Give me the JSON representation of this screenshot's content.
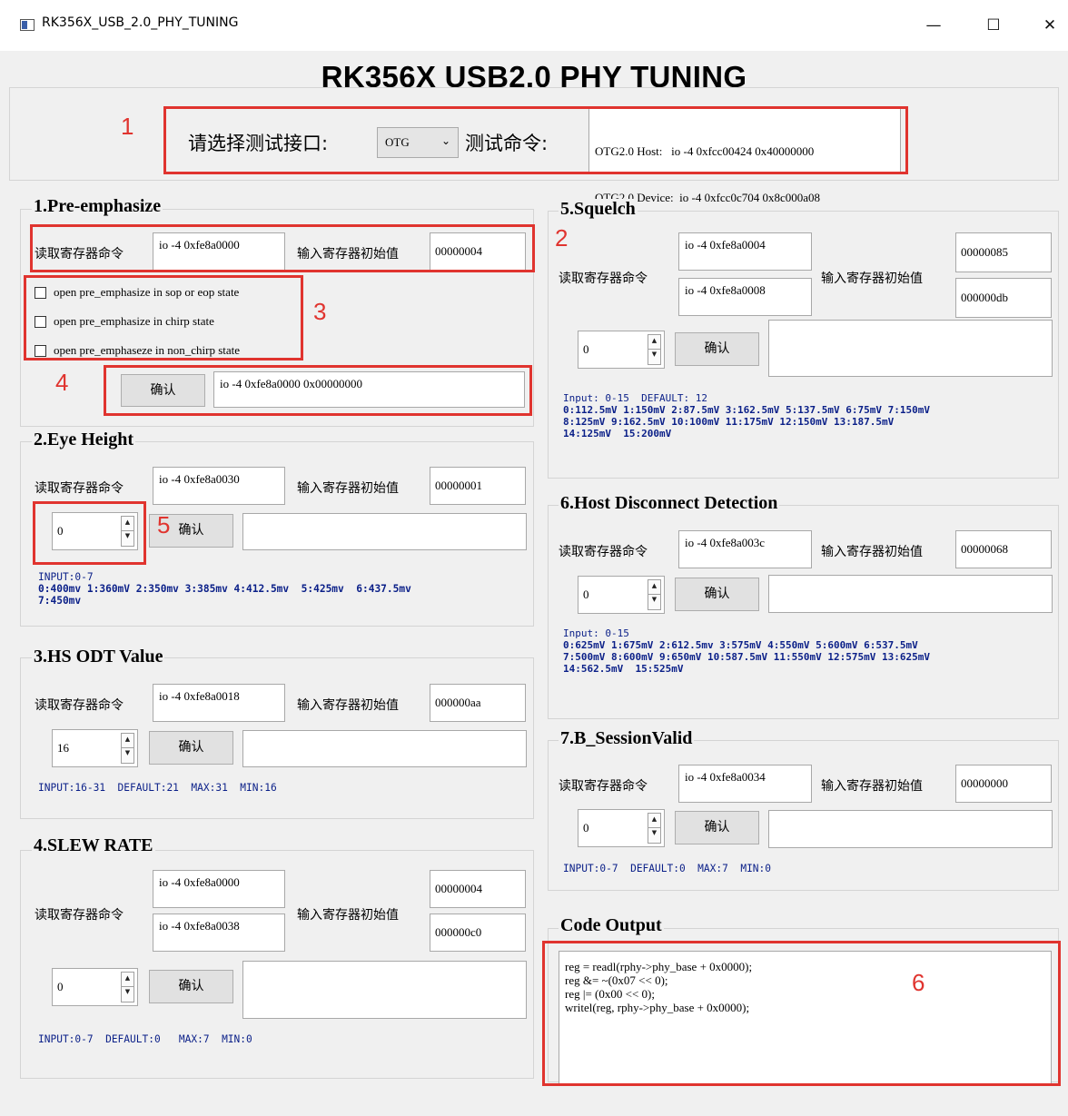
{
  "window": {
    "title": "RK356X_USB_2.0_PHY_TUNING",
    "minimize_glyph": "—",
    "maximize_glyph": "☐",
    "close_glyph": "✕"
  },
  "header": {
    "title": "RK356X USB2.0 PHY TUNING",
    "select_label": "请选择测试接口:",
    "select_value": "OTG",
    "cmd_label": "测试命令:",
    "cmd_lines": [
      "OTG2.0 Host:   io -4 0xfcc00424 0x40000000",
      "OTG2.0 Device:  io -4 0xfcc0c704 0x8c000a08"
    ]
  },
  "common": {
    "read_cmd_label": "读取寄存器命令",
    "init_value_label": "输入寄存器初始值",
    "confirm_label": "确认"
  },
  "pre_emphasize": {
    "title": "1.Pre-emphasize",
    "read_cmd": "io -4 0xfe8a0000",
    "init_value": "00000004",
    "options": [
      "open pre_emphasize in sop or eop state",
      "open pre_emphasize in chirp state",
      "open pre_emphaseze in non_chirp state"
    ],
    "output": "io -4 0xfe8a0000 0x00000000"
  },
  "eye_height": {
    "title": "2.Eye Height",
    "read_cmd": "io -4 0xfe8a0030",
    "init_value": "00000001",
    "spin_value": "0",
    "output": "",
    "hint_lines": [
      "INPUT:0-7",
      "0:400mv 1:360mV 2:350mv 3:385mv 4:412.5mv  5:425mv  6:437.5mv",
      "7:450mv"
    ]
  },
  "hs_odt": {
    "title": "3.HS ODT Value",
    "read_cmd": "io -4 0xfe8a0018",
    "init_value": "000000aa",
    "spin_value": "16",
    "output": "",
    "hint": "INPUT:16-31  DEFAULT:21  MAX:31  MIN:16"
  },
  "slew_rate": {
    "title": "4.SLEW RATE",
    "read_cmd_1": "io -4 0xfe8a0000",
    "read_cmd_2": "io -4 0xfe8a0038",
    "init_value_1": "00000004",
    "init_value_2": "000000c0",
    "spin_value": "0",
    "output": "",
    "hint": "INPUT:0-7  DEFAULT:0   MAX:7  MIN:0"
  },
  "squelch": {
    "title": "5.Squelch",
    "read_cmd_1": "io -4 0xfe8a0004",
    "read_cmd_2": "io -4 0xfe8a0008",
    "init_value_1": "00000085",
    "init_value_2": "000000db",
    "spin_value": "0",
    "output": "",
    "hint_lines": [
      "Input: 0-15  DEFAULT: 12",
      "0:112.5mV 1:150mV 2:87.5mV 3:162.5mV 5:137.5mV 6:75mV 7:150mV",
      "8:125mV 9:162.5mV 10:100mV 11:175mV 12:150mV 13:187.5mV",
      "14:125mV  15:200mV"
    ]
  },
  "host_disconnect": {
    "title": "6.Host Disconnect Detection",
    "read_cmd": "io -4 0xfe8a003c",
    "init_value": "00000068",
    "spin_value": "0",
    "output": "",
    "hint_lines": [
      "Input: 0-15",
      "0:625mV 1:675mV 2:612.5mv 3:575mV 4:550mV 5:600mV 6:537.5mV",
      "7:500mV 8:600mV 9:650mV 10:587.5mV 11:550mV 12:575mV 13:625mV",
      "14:562.5mV  15:525mV"
    ]
  },
  "b_session": {
    "title": "7.B_SessionValid",
    "read_cmd": "io -4 0xfe8a0034",
    "init_value": "00000000",
    "spin_value": "0",
    "output": "",
    "hint": "INPUT:0-7  DEFAULT:0  MAX:7  MIN:0"
  },
  "code_output": {
    "title": "Code Output",
    "lines": [
      "reg = readl(rphy->phy_base + 0x0000);",
      "reg &= ~(0x07 << 0);",
      "reg |= (0x00 << 0);",
      "writel(reg, rphy->phy_base + 0x0000);"
    ]
  },
  "annotations": [
    "1",
    "2",
    "3",
    "4",
    "5",
    "6"
  ],
  "colors": {
    "annotation_red": "#e0342f",
    "hint_blue": "#0a1f88",
    "window_bg": "#f0f0f0"
  }
}
